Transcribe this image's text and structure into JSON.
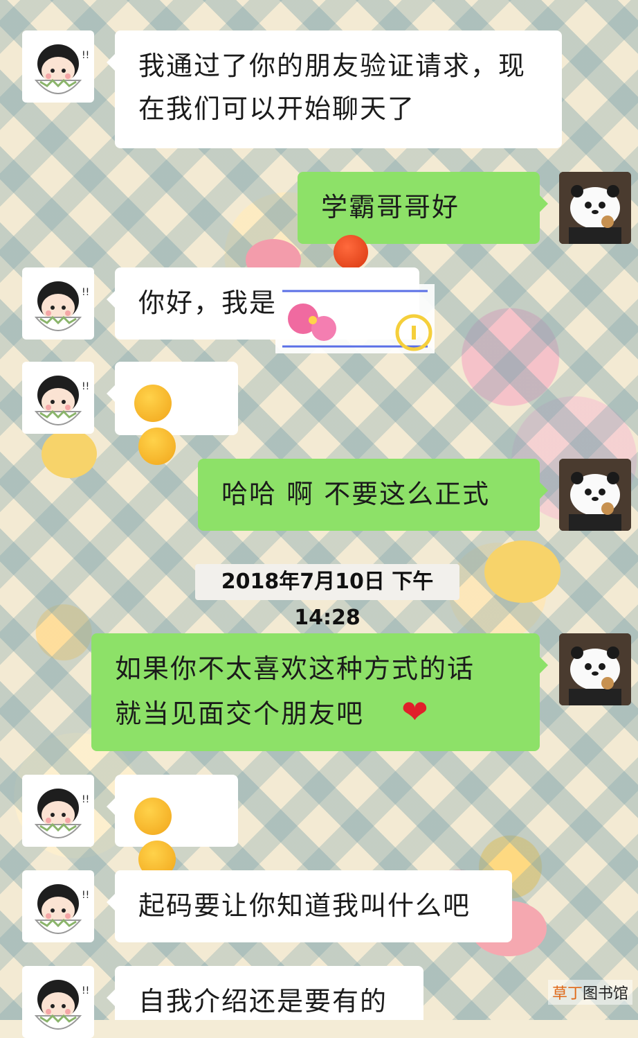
{
  "messages": [
    {
      "id": "m1",
      "side": "in",
      "text_line1": "我通过了你的朋友验证请求，现",
      "text_line2": "在我们可以开始聊天了"
    },
    {
      "id": "m2",
      "side": "out",
      "text": "学霸哥哥好",
      "emoji": "flushed-face-red"
    },
    {
      "id": "m3",
      "side": "in",
      "text": "你好，我是"
    },
    {
      "id": "m4",
      "side": "in",
      "emoji": [
        "angry-face",
        "angry-face"
      ]
    },
    {
      "id": "m5",
      "side": "out",
      "text": "哈哈 啊 不要这么正式"
    },
    {
      "id": "m6",
      "side": "out",
      "text_line1": "如果你不太喜欢这种方式的话",
      "text_line2": "就当见面交个朋友吧",
      "emoji": "red-heart"
    },
    {
      "id": "m7",
      "side": "in",
      "emoji": [
        "grinning-face",
        "grinning-face"
      ]
    },
    {
      "id": "m8",
      "side": "in",
      "text": "起码要让你知道我叫什么吧"
    },
    {
      "id": "m9",
      "side": "in",
      "text": "自我介绍还是要有的"
    }
  ],
  "timestamp": "2018年7月10日 下午14:28",
  "watermark": {
    "accent": "草丁",
    "rest": "图书馆"
  },
  "colors": {
    "outgoing_bubble": "#8de168",
    "incoming_bubble": "#ffffff"
  }
}
